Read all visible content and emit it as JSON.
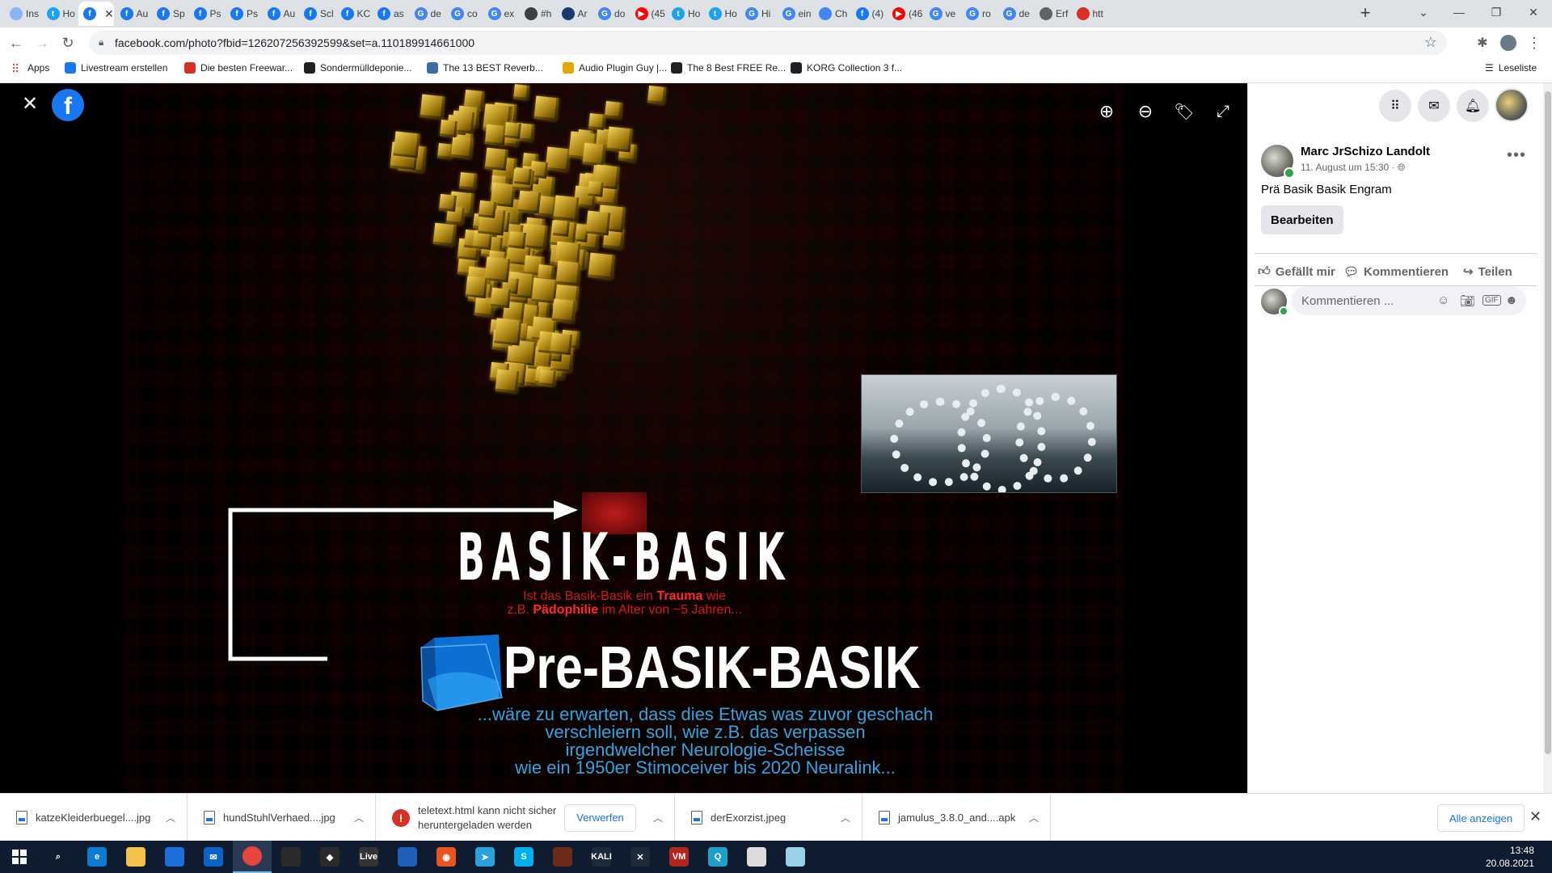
{
  "browser": {
    "tabs": [
      {
        "label": "Ins",
        "icon": "google-lens",
        "color": "#8ab4f8"
      },
      {
        "label": "Ho",
        "icon": "twitter",
        "color": "#1da1f2"
      },
      {
        "label": "",
        "icon": "facebook",
        "color": "#1877f2",
        "active": true
      },
      {
        "label": "Au",
        "icon": "facebook",
        "color": "#1877f2"
      },
      {
        "label": "Sp",
        "icon": "facebook",
        "color": "#1877f2"
      },
      {
        "label": "Ps",
        "icon": "facebook",
        "color": "#1877f2"
      },
      {
        "label": "Ps",
        "icon": "facebook",
        "color": "#1877f2"
      },
      {
        "label": "Au",
        "icon": "facebook",
        "color": "#1877f2"
      },
      {
        "label": "Scl",
        "icon": "facebook",
        "color": "#1877f2"
      },
      {
        "label": "KC",
        "icon": "facebook",
        "color": "#1877f2"
      },
      {
        "label": "as",
        "icon": "facebook",
        "color": "#1877f2"
      },
      {
        "label": "de",
        "icon": "google",
        "color": "#4285f4"
      },
      {
        "label": "co",
        "icon": "google",
        "color": "#4285f4"
      },
      {
        "label": "ex",
        "icon": "google",
        "color": "#4285f4"
      },
      {
        "label": "#h",
        "icon": "circle",
        "color": "#3c4043"
      },
      {
        "label": "Ar",
        "icon": "site",
        "color": "#1a3a6a"
      },
      {
        "label": "do",
        "icon": "google",
        "color": "#4285f4"
      },
      {
        "label": "(45",
        "icon": "youtube",
        "color": "#ff0000"
      },
      {
        "label": "Ho",
        "icon": "twitter",
        "color": "#1da1f2"
      },
      {
        "label": "Ho",
        "icon": "twitter",
        "color": "#1da1f2"
      },
      {
        "label": "Hi",
        "icon": "google",
        "color": "#4285f4"
      },
      {
        "label": "ein",
        "icon": "google",
        "color": "#4285f4"
      },
      {
        "label": "Ch",
        "icon": "doc",
        "color": "#4285f4"
      },
      {
        "label": "(4)",
        "icon": "facebook",
        "color": "#1877f2"
      },
      {
        "label": "(46",
        "icon": "youtube",
        "color": "#ff0000"
      },
      {
        "label": "ve",
        "icon": "google",
        "color": "#4285f4"
      },
      {
        "label": "ro",
        "icon": "google",
        "color": "#4285f4"
      },
      {
        "label": "de",
        "icon": "google",
        "color": "#4285f4"
      },
      {
        "label": "Erf",
        "icon": "puzzle",
        "color": "#5f6368"
      },
      {
        "label": "htt",
        "icon": "oa",
        "color": "#d93025"
      }
    ],
    "url": "facebook.com/photo?fbid=126207256392599&set=a.110189914661000",
    "bookmarks": [
      {
        "label": "Apps",
        "color": "#ea4335"
      },
      {
        "label": "Livestream erstellen",
        "color": "#1877f2"
      },
      {
        "label": "Die besten Freewar...",
        "color": "#d93025"
      },
      {
        "label": "Sondermülldeponie...",
        "color": "#202124"
      },
      {
        "label": "The 13 BEST Reverb...",
        "color": "#3a6ea5"
      },
      {
        "label": "Audio Plugin Guy |...",
        "color": "#e0a800"
      },
      {
        "label": "The 8 Best FREE Re...",
        "color": "#202124"
      },
      {
        "label": "KORG Collection 3 f...",
        "color": "#202124"
      }
    ],
    "reading_list": "Leseliste"
  },
  "photo": {
    "title": "BASIK-BASIK",
    "question_line1_a": "Ist das Basik-Basik ein ",
    "question_line1_b": "Trauma",
    "question_line1_c": " wie",
    "question_line2_a": "z.B. ",
    "question_line2_b": "Pädophilie",
    "question_line2_c": " im Alter von ~5 Jahren...",
    "subtitle": "Pre-BASIK-BASIK",
    "note_lines": [
      "...wäre zu erwarten, dass dies Etwas was zuvor geschach",
      "verschleiern soll, wie z.B. das verpassen",
      "irgendwelcher Neurologie-Scheisse",
      "wie ein 1950er Stimoceiver bis 2020 Neuralink..."
    ]
  },
  "post": {
    "author": "Marc JrSchizo Landolt",
    "date": "11. August um 15:30 ·",
    "caption": "Prä Basik Basik Engram",
    "edit_label": "Bearbeiten",
    "like_label": "Gefällt mir",
    "comment_label": "Kommentieren",
    "share_label": "Teilen",
    "comment_placeholder": "Kommentieren ..."
  },
  "downloads": {
    "items": [
      {
        "name": "katzeKleiderbuegel....jpg"
      },
      {
        "name": "hundStuhlVerhaed....jpg"
      },
      {
        "name": "jamulus_3.8.0_and....apk"
      }
    ],
    "warning_line1": "teletext.html kann nicht sicher",
    "warning_line2": "heruntergeladen werden",
    "discard_label": "Verwerfen",
    "second_item": "derExorzist.jpeg",
    "show_all": "Alle anzeigen"
  },
  "taskbar": {
    "time": "13:48",
    "date": "20.08.2021",
    "apps": [
      {
        "name": "search",
        "color": "#0f1b2e",
        "text": "⌕"
      },
      {
        "name": "edge",
        "color": "#0c7bd4",
        "text": "e"
      },
      {
        "name": "file-explorer",
        "color": "#f2c14e",
        "text": ""
      },
      {
        "name": "store",
        "color": "#1c6ed8",
        "text": ""
      },
      {
        "name": "mail",
        "color": "#0a64c8",
        "text": "✉"
      },
      {
        "name": "chrome",
        "color": "#e8453c",
        "text": ""
      },
      {
        "name": "game",
        "color": "#2a2a2a",
        "text": ""
      },
      {
        "name": "inkscape",
        "color": "#2a2a2a",
        "text": "◆"
      },
      {
        "name": "live",
        "color": "#333333",
        "text": "Live"
      },
      {
        "name": "virtualbox",
        "color": "#1f5fb8",
        "text": ""
      },
      {
        "name": "ubuntu",
        "color": "#e95420",
        "text": "◉"
      },
      {
        "name": "telegram",
        "color": "#2aa1da",
        "text": "➤"
      },
      {
        "name": "skype",
        "color": "#00aff0",
        "text": "S"
      },
      {
        "name": "tool",
        "color": "#6b2b1a",
        "text": ""
      },
      {
        "name": "kali",
        "color": "#1c2a3a",
        "text": "KALI"
      },
      {
        "name": "x-app",
        "color": "#1c2a3a",
        "text": "✕"
      },
      {
        "name": "voicemeeter",
        "color": "#b3261e",
        "text": "VM"
      },
      {
        "name": "chat",
        "color": "#1da0c7",
        "text": "Q"
      },
      {
        "name": "notepad",
        "color": "#dcdcdc",
        "text": ""
      },
      {
        "name": "app",
        "color": "#9ad0e8",
        "text": ""
      }
    ]
  },
  "colors": {
    "facebook_blue": "#1877f2",
    "title_red": "#d11b1b",
    "note_blue": "#2fa6e0"
  }
}
